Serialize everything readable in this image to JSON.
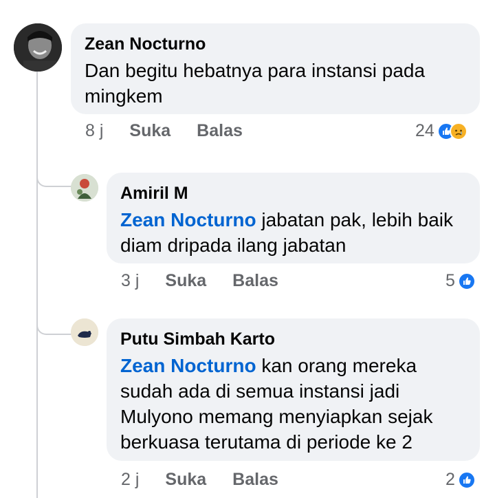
{
  "comments": [
    {
      "author": "Zean Nocturno",
      "mention": "",
      "text": "Dan begitu hebatnya para instansi pada mingkem",
      "time": "8 j",
      "like_label": "Suka",
      "reply_label": "Balas",
      "reaction_count": "24",
      "reactions": [
        "like-icon",
        "sad-icon"
      ]
    },
    {
      "author": "Amiril M",
      "mention": "Zean Nocturno",
      "text": "jabatan pak, lebih baik diam dripada ilang jabatan",
      "time": "3 j",
      "like_label": "Suka",
      "reply_label": "Balas",
      "reaction_count": "5",
      "reactions": [
        "like-icon"
      ]
    },
    {
      "author": "Putu Simbah Karto",
      "mention": "Zean Nocturno",
      "text": "kan orang mereka sudah ada di semua instansi jadi Mulyono memang menyiapkan sejak berkuasa terutama di periode ke 2",
      "time": "2 j",
      "like_label": "Suka",
      "reply_label": "Balas",
      "reaction_count": "2",
      "reactions": [
        "like-icon"
      ]
    }
  ],
  "colors": {
    "bubble_bg": "#f0f2f5",
    "mention": "#0064d1",
    "meta_text": "#65676b",
    "like_blue": "#1877f2",
    "sad_yellow": "#f7b125"
  }
}
